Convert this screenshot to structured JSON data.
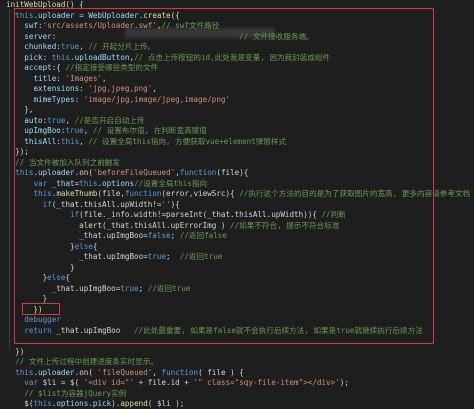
{
  "editor": {
    "lines": [
      [
        {
          "c": "fn",
          "t": "initWebUpload"
        },
        {
          "c": "pl",
          "t": "() {"
        }
      ],
      [
        {
          "c": "pl",
          "t": "  "
        },
        {
          "c": "kw",
          "t": "this"
        },
        {
          "c": "pl",
          "t": "."
        },
        {
          "c": "pr",
          "t": "uploader"
        },
        {
          "c": "pl",
          "t": " = "
        },
        {
          "c": "pr",
          "t": "WebUploader"
        },
        {
          "c": "pl",
          "t": "."
        },
        {
          "c": "fn",
          "t": "create"
        },
        {
          "c": "pl",
          "t": "({"
        }
      ],
      [
        {
          "c": "pl",
          "t": "    "
        },
        {
          "c": "pr",
          "t": "swf"
        },
        {
          "c": "pl",
          "t": ":"
        },
        {
          "c": "str",
          "t": "'src/assets/Uploader.swf'"
        },
        {
          "c": "pl",
          "t": ","
        },
        {
          "c": "cm",
          "t": "// swf文件路径"
        }
      ],
      [
        {
          "c": "pl",
          "t": "    "
        },
        {
          "c": "pr",
          "t": "server"
        },
        {
          "c": "pl",
          "t": ":"
        },
        {
          "c": "cm",
          "t": "                                        // 文件接收服务端。"
        }
      ],
      [
        {
          "c": "pl",
          "t": "    "
        },
        {
          "c": "pr",
          "t": "chunked"
        },
        {
          "c": "pl",
          "t": ":"
        },
        {
          "c": "kw",
          "t": "true"
        },
        {
          "c": "pl",
          "t": ", "
        },
        {
          "c": "cm",
          "t": "// 开起分片上传。"
        }
      ],
      [
        {
          "c": "pl",
          "t": "    "
        },
        {
          "c": "pr",
          "t": "pick"
        },
        {
          "c": "pl",
          "t": ": "
        },
        {
          "c": "kw",
          "t": "this"
        },
        {
          "c": "pl",
          "t": "."
        },
        {
          "c": "pr",
          "t": "uploadButton"
        },
        {
          "c": "pl",
          "t": ","
        },
        {
          "c": "cm",
          "t": "// 点击上传按钮的id,此处我是变量, 因为我封装成组件"
        }
      ],
      [
        {
          "c": "pl",
          "t": "    "
        },
        {
          "c": "pr",
          "t": "accept"
        },
        {
          "c": "pl",
          "t": ":{ "
        },
        {
          "c": "cm",
          "t": "//指定接受哪些类型的文件"
        }
      ],
      [
        {
          "c": "pl",
          "t": "      "
        },
        {
          "c": "pr",
          "t": "title"
        },
        {
          "c": "pl",
          "t": ": "
        },
        {
          "c": "str",
          "t": "'Images'"
        },
        {
          "c": "pl",
          "t": ","
        }
      ],
      [
        {
          "c": "pl",
          "t": "      "
        },
        {
          "c": "pr",
          "t": "extensions"
        },
        {
          "c": "pl",
          "t": ": "
        },
        {
          "c": "str",
          "t": "'jpg,jpeg,png'"
        },
        {
          "c": "pl",
          "t": ","
        }
      ],
      [
        {
          "c": "pl",
          "t": "      "
        },
        {
          "c": "pr",
          "t": "mimeTypes"
        },
        {
          "c": "pl",
          "t": ": "
        },
        {
          "c": "str",
          "t": "'image/jpg,image/jpeg,image/png'"
        }
      ],
      [
        {
          "c": "pl",
          "t": "    },"
        }
      ],
      [
        {
          "c": "pl",
          "t": "    "
        },
        {
          "c": "pr",
          "t": "auto"
        },
        {
          "c": "pl",
          "t": ":"
        },
        {
          "c": "kw",
          "t": "true"
        },
        {
          "c": "pl",
          "t": ", "
        },
        {
          "c": "cm",
          "t": "//是否开启自动上传"
        }
      ],
      [
        {
          "c": "pl",
          "t": "    "
        },
        {
          "c": "pr",
          "t": "upImgBoo"
        },
        {
          "c": "pl",
          "t": ":"
        },
        {
          "c": "kw",
          "t": "true"
        },
        {
          "c": "pl",
          "t": ", "
        },
        {
          "c": "cm",
          "t": "// 设置布尔值, 在判断宽高赋值"
        }
      ],
      [
        {
          "c": "pl",
          "t": "    "
        },
        {
          "c": "pr",
          "t": "thisAll"
        },
        {
          "c": "pl",
          "t": ":"
        },
        {
          "c": "kw",
          "t": "this"
        },
        {
          "c": "pl",
          "t": ", "
        },
        {
          "c": "cm",
          "t": "// 设置全局this指向, 方便获取vue+element弹窗样式"
        }
      ],
      [
        {
          "c": "pl",
          "t": "  });"
        }
      ],
      [
        {
          "c": "pl",
          "t": "  "
        },
        {
          "c": "cm",
          "t": "// 当文件被加入队列之前触发"
        }
      ],
      [
        {
          "c": "pl",
          "t": "  "
        },
        {
          "c": "kw",
          "t": "this"
        },
        {
          "c": "pl",
          "t": "."
        },
        {
          "c": "pr",
          "t": "uploader"
        },
        {
          "c": "pl",
          "t": "."
        },
        {
          "c": "fn",
          "t": "on"
        },
        {
          "c": "pl",
          "t": "("
        },
        {
          "c": "str",
          "t": "'beforeFileQueued'"
        },
        {
          "c": "pl",
          "t": ","
        },
        {
          "c": "kw",
          "t": "function"
        },
        {
          "c": "pl",
          "t": "(file){"
        }
      ],
      [
        {
          "c": "pl",
          "t": "      "
        },
        {
          "c": "kw",
          "t": "var"
        },
        {
          "c": "pl",
          "t": " "
        },
        {
          "c": "pr",
          "t": "_that"
        },
        {
          "c": "pl",
          "t": "="
        },
        {
          "c": "kw",
          "t": "this"
        },
        {
          "c": "pl",
          "t": "."
        },
        {
          "c": "pr",
          "t": "options"
        },
        {
          "c": "cm",
          "t": "//设置全局this指向"
        }
      ],
      [
        {
          "c": "pl",
          "t": "      "
        },
        {
          "c": "kw",
          "t": "this"
        },
        {
          "c": "pl",
          "t": "."
        },
        {
          "c": "fn",
          "t": "makeThumb"
        },
        {
          "c": "pl",
          "t": "(file,"
        },
        {
          "c": "kw",
          "t": "function"
        },
        {
          "c": "pl",
          "t": "(error,viewSrc){ "
        },
        {
          "c": "cm",
          "t": "//执行这个方法的目的是为了获取图片的宽高, 更多内容请参考文档"
        }
      ],
      [
        {
          "c": "pl",
          "t": "        "
        },
        {
          "c": "kw",
          "t": "if"
        },
        {
          "c": "pl",
          "t": "(_that.thisAll.upWidth!="
        },
        {
          "c": "str",
          "t": "''"
        },
        {
          "c": "pl",
          "t": "){"
        }
      ],
      [
        {
          "c": "pl",
          "t": "              "
        },
        {
          "c": "kw",
          "t": "if"
        },
        {
          "c": "pl",
          "t": "(file._info.width!=parseInt(_that.thisAll.upWidth)){ "
        },
        {
          "c": "cm",
          "t": "//判断"
        }
      ],
      [
        {
          "c": "pl",
          "t": "                "
        },
        {
          "c": "fn",
          "t": "alert"
        },
        {
          "c": "pl",
          "t": "(_that.thisAll.upErrorImg ) "
        },
        {
          "c": "cm",
          "t": "//如果不符合, 提示不符合标准"
        }
      ],
      [
        {
          "c": "pl",
          "t": "                _that.upImgBoo="
        },
        {
          "c": "kw",
          "t": "false"
        },
        {
          "c": "pl",
          "t": "; "
        },
        {
          "c": "cm",
          "t": "//返回false"
        }
      ],
      [
        {
          "c": "pl",
          "t": "              }"
        },
        {
          "c": "kw",
          "t": "else"
        },
        {
          "c": "pl",
          "t": "{"
        }
      ],
      [
        {
          "c": "pl",
          "t": "                _that.upImgBoo="
        },
        {
          "c": "kw",
          "t": "true"
        },
        {
          "c": "pl",
          "t": ";  "
        },
        {
          "c": "cm",
          "t": "//返回true"
        }
      ],
      [
        {
          "c": "pl",
          "t": "              }"
        }
      ],
      [
        {
          "c": "pl",
          "t": "        }"
        },
        {
          "c": "kw",
          "t": "else"
        },
        {
          "c": "pl",
          "t": "{"
        }
      ],
      [
        {
          "c": "pl",
          "t": "          _that.upImgBoo="
        },
        {
          "c": "kw",
          "t": "true"
        },
        {
          "c": "pl",
          "t": "; "
        },
        {
          "c": "cm",
          "t": "//返回true"
        }
      ],
      [
        {
          "c": "pl",
          "t": "        }"
        }
      ],
      [
        {
          "c": "cur",
          "t": "      })"
        }
      ],
      [
        {
          "c": "pl",
          "t": "    "
        },
        {
          "c": "kw",
          "t": "debugger"
        }
      ],
      [
        {
          "c": "pl",
          "t": "    "
        },
        {
          "c": "kw",
          "t": "return"
        },
        {
          "c": "pl",
          "t": " _that.upImgBoo   "
        },
        {
          "c": "cm",
          "t": "//此处最重要, 如果是false就不会执行后续方法, 如果是true就继续执行后续方法"
        }
      ],
      [
        {
          "c": "pl",
          "t": ""
        }
      ],
      [
        {
          "c": "pl",
          "t": "  })"
        }
      ],
      [
        {
          "c": "pl",
          "t": "  "
        },
        {
          "c": "cm",
          "t": "// 文件上传过程中创建进度条实时显示。"
        }
      ],
      [
        {
          "c": "pl",
          "t": "  "
        },
        {
          "c": "kw",
          "t": "this"
        },
        {
          "c": "pl",
          "t": "."
        },
        {
          "c": "pr",
          "t": "uploader"
        },
        {
          "c": "pl",
          "t": "."
        },
        {
          "c": "fn",
          "t": "on"
        },
        {
          "c": "pl",
          "t": "( "
        },
        {
          "c": "str",
          "t": "'fileQueued'"
        },
        {
          "c": "pl",
          "t": ", "
        },
        {
          "c": "kw",
          "t": "function"
        },
        {
          "c": "pl",
          "t": "( file ) {"
        }
      ],
      [
        {
          "c": "pl",
          "t": "    "
        },
        {
          "c": "kw",
          "t": "var"
        },
        {
          "c": "pl",
          "t": " $li = $( "
        },
        {
          "c": "str",
          "t": "'<div id=\"'"
        },
        {
          "c": "pl",
          "t": " + file.id + "
        },
        {
          "c": "str",
          "t": "'\" class=\"sqy-file-item\"></div>'"
        },
        {
          "c": "pl",
          "t": ");"
        }
      ],
      [
        {
          "c": "pl",
          "t": "    "
        },
        {
          "c": "cm",
          "t": "// $list为容器jQuery实例"
        }
      ],
      [
        {
          "c": "pl",
          "t": "    $("
        },
        {
          "c": "kw",
          "t": "this"
        },
        {
          "c": "pl",
          "t": "."
        },
        {
          "c": "pr",
          "t": "options"
        },
        {
          "c": "pl",
          "t": "."
        },
        {
          "c": "pr",
          "t": "pick"
        },
        {
          "c": "pl",
          "t": ")."
        },
        {
          "c": "fn",
          "t": "append"
        },
        {
          "c": "pl",
          "t": "( $li );"
        }
      ]
    ]
  }
}
